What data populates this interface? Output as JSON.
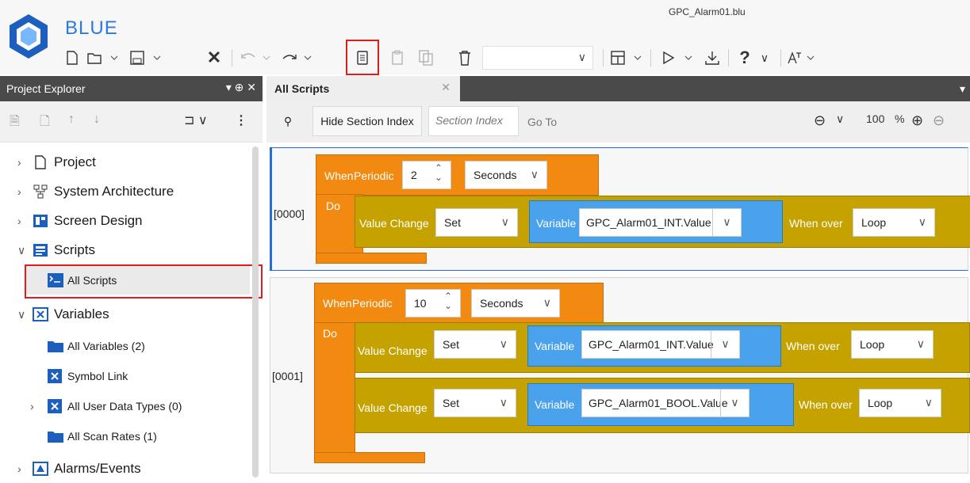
{
  "app": {
    "name": "BLUE",
    "file": "GPC_Alarm01.blu"
  },
  "project_explorer": {
    "title": "Project Explorer",
    "pin_close": "▾ ⊕ ✕",
    "tree": [
      {
        "label": "Project"
      },
      {
        "label": "System Architecture"
      },
      {
        "label": "Screen Design"
      },
      {
        "label": "Scripts"
      },
      {
        "label": "All Scripts"
      },
      {
        "label": "Variables"
      },
      {
        "label": "All Variables (2)"
      },
      {
        "label": "Symbol Link"
      },
      {
        "label": "All User Data Types (0)"
      },
      {
        "label": "All Scan Rates (1)"
      },
      {
        "label": "Alarms/Events"
      }
    ]
  },
  "doc": {
    "tab": "All Scripts",
    "hide_section_index": "Hide Section Index",
    "section_index_placeholder": "Section Index",
    "go_to": "Go To",
    "zoom_value": "100",
    "zoom_unit": "%"
  },
  "sections": [
    {
      "index": "[0000]",
      "when": "When",
      "periodic": "Periodic",
      "period": "2",
      "unit": "Seconds",
      "do": "Do",
      "rows": [
        {
          "label": "Value Change",
          "op": "Set",
          "var_label": "Variable",
          "var": "GPC_Alarm01_INT.Value",
          "when_over": "When over",
          "mode": "Loop"
        }
      ]
    },
    {
      "index": "[0001]",
      "when": "When",
      "periodic": "Periodic",
      "period": "10",
      "unit": "Seconds",
      "do": "Do",
      "rows": [
        {
          "label": "Value Change",
          "op": "Set",
          "var_label": "Variable",
          "var": "GPC_Alarm01_INT.Value",
          "when_over": "When over",
          "mode": "Loop"
        },
        {
          "label": "Value Change",
          "op": "Set",
          "var_label": "Variable",
          "var": "GPC_Alarm01_BOOL.Value",
          "when_over": "When over",
          "mode": "Loop"
        }
      ]
    }
  ],
  "colors": {
    "accent": "#2a7ae2",
    "event_block": "#f28a12",
    "action_block": "#c5a200",
    "variable_block": "#4aa2ec",
    "highlight": "#e31b1b"
  }
}
